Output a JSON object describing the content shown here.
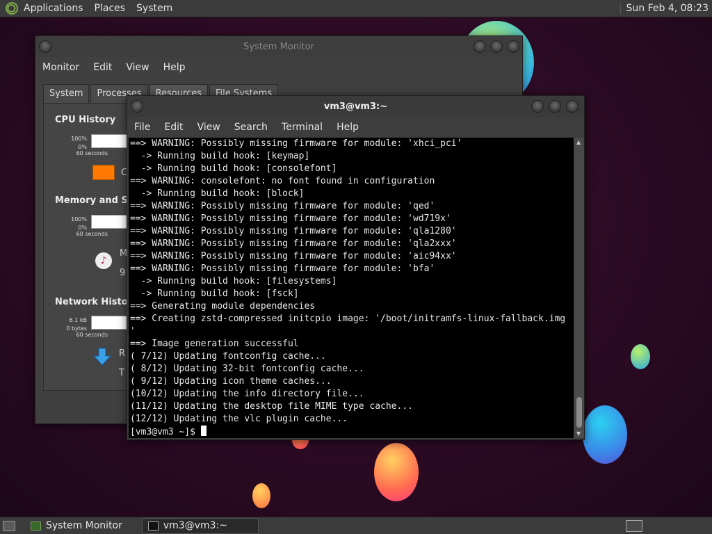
{
  "top_panel": {
    "menus": [
      "Applications",
      "Places",
      "System"
    ],
    "clock": "Sun Feb  4, 08:23"
  },
  "system_monitor": {
    "title": "System Monitor",
    "menus": [
      "Monitor",
      "Edit",
      "View",
      "Help"
    ],
    "tabs": [
      "System",
      "Processes",
      "Resources",
      "File Systems"
    ],
    "active_tab": "Resources",
    "cpu": {
      "heading": "CPU History",
      "top": "100%",
      "bottom": "0%",
      "span": "60 seconds",
      "legend_partial": "C",
      "color": "#ff7a00"
    },
    "memory": {
      "heading": "Memory and Swa",
      "top": "100%",
      "bottom": "0%",
      "span": "60 seconds",
      "legend_partial": "M",
      "value_partial": "9"
    },
    "network": {
      "heading": "Network History",
      "top": "6.1 kB",
      "bottom": "0 bytes",
      "span": "60 seconds",
      "recv_partial": "R",
      "total_partial": "T"
    }
  },
  "terminal": {
    "title": "vm3@vm3:~",
    "menus": [
      "File",
      "Edit",
      "View",
      "Search",
      "Terminal",
      "Help"
    ],
    "lines": [
      "==> WARNING: Possibly missing firmware for module: 'xhci_pci'",
      "  -> Running build hook: [keymap]",
      "  -> Running build hook: [consolefont]",
      "==> WARNING: consolefont: no font found in configuration",
      "  -> Running build hook: [block]",
      "==> WARNING: Possibly missing firmware for module: 'qed'",
      "==> WARNING: Possibly missing firmware for module: 'wd719x'",
      "==> WARNING: Possibly missing firmware for module: 'qla1280'",
      "==> WARNING: Possibly missing firmware for module: 'qla2xxx'",
      "==> WARNING: Possibly missing firmware for module: 'aic94xx'",
      "==> WARNING: Possibly missing firmware for module: 'bfa'",
      "  -> Running build hook: [filesystems]",
      "  -> Running build hook: [fsck]",
      "==> Generating module dependencies",
      "==> Creating zstd-compressed initcpio image: '/boot/initramfs-linux-fallback.img",
      "'",
      "==> Image generation successful",
      "( 7/12) Updating fontconfig cache...",
      "( 8/12) Updating 32-bit fontconfig cache...",
      "( 9/12) Updating icon theme caches...",
      "(10/12) Updating the info directory file...",
      "(11/12) Updating the desktop file MIME type cache...",
      "(12/12) Updating the vlc plugin cache..."
    ],
    "prompt": "[vm3@vm3 ~]$ "
  },
  "taskbar": {
    "tasks": [
      "System Monitor",
      "vm3@vm3:~"
    ]
  }
}
